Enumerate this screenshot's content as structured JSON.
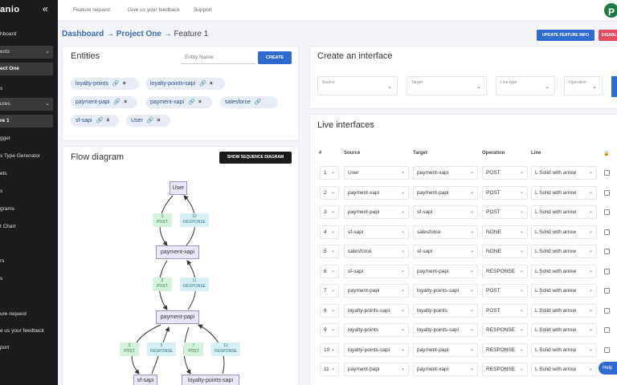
{
  "app": {
    "logo_text": "anio"
  },
  "sidebar": {
    "items": [
      {
        "label": "hboard"
      },
      {
        "label": "ects"
      },
      {
        "label": "ect One"
      },
      {
        "label": "s"
      },
      {
        "label": "ures"
      },
      {
        "label": "re 1"
      },
      {
        "label": "gger"
      },
      {
        "label": "s Type Generator"
      },
      {
        "label": "ets"
      },
      {
        "label": "s"
      },
      {
        "label": "grams"
      },
      {
        "label": "t Chart"
      },
      {
        "label": "rs"
      },
      {
        "label": "s"
      },
      {
        "label": "ure request"
      },
      {
        "label": "e us your feedback"
      },
      {
        "label": "port"
      }
    ]
  },
  "topbar": {
    "links": [
      "Feature request",
      "Give us your feedback",
      "Support"
    ],
    "avatar_letter": "P"
  },
  "breadcrumb": {
    "dashboard": "Dashboard",
    "sep": "→",
    "project": "Project One",
    "current": "Feature 1"
  },
  "actions": {
    "update_label": "UPDATE FEATURE INFO",
    "disable_label": "DISABLE"
  },
  "entities": {
    "title": "Entities",
    "input_placeholder": "Entity Name",
    "create_label": "CREATE",
    "chips": [
      "loyalty-points",
      "loyalty-points-sapi",
      "payment-papi",
      "payment-xapi",
      "salesforce",
      "sf-sapi",
      "User"
    ]
  },
  "flow": {
    "title": "Flow diagram",
    "seq_button": "SHOW SEQUENCE DIAGRAM",
    "nodes": [
      "User",
      "payment-xapi",
      "payment-papi",
      "sf-sapi",
      "loyalty-points-sapi"
    ],
    "labels": [
      {
        "n": "1",
        "op": "POST"
      },
      {
        "n": "12",
        "op": "RESPONSE"
      },
      {
        "n": "2",
        "op": "POST"
      },
      {
        "n": "11",
        "op": "RESPONSE"
      },
      {
        "n": "3",
        "op": "POST"
      },
      {
        "n": "6",
        "op": "RESPONSE"
      },
      {
        "n": "7",
        "op": "POST"
      },
      {
        "n": "10",
        "op": "RESPONSE"
      }
    ]
  },
  "create_interface": {
    "title": "Create an interface",
    "fields": [
      "Source",
      "Target",
      "Line type",
      "Operation"
    ]
  },
  "live": {
    "title": "Live interfaces",
    "columns": {
      "num": "#",
      "source": "Source",
      "target": "Target",
      "operation": "Operation",
      "line": "Line"
    },
    "rows": [
      {
        "n": "1",
        "source": "User",
        "target": "payment-xapi",
        "op": "POST",
        "line": "L Solid with arrow"
      },
      {
        "n": "2",
        "source": "payment-xapi",
        "target": "payment-papi",
        "op": "POST",
        "line": "L Solid with arrow"
      },
      {
        "n": "3",
        "source": "payment-papi",
        "target": "sf-sapi",
        "op": "POST",
        "line": "L Solid with arrow"
      },
      {
        "n": "4",
        "source": "sf-sapi",
        "target": "salesforce",
        "op": "NONE",
        "line": "L Solid with arrow"
      },
      {
        "n": "5",
        "source": "salesforce",
        "target": "sf-sapi",
        "op": "NONE",
        "line": "L Solid with arrow"
      },
      {
        "n": "6",
        "source": "sf-sapi",
        "target": "payment-papi",
        "op": "RESPONSE",
        "line": "L Solid with arrow"
      },
      {
        "n": "7",
        "source": "payment-papi",
        "target": "loyalty-points-sapi",
        "op": "POST",
        "line": "L Solid with arrow"
      },
      {
        "n": "8",
        "source": "loyalty-points-sapi",
        "target": "loyalty-points",
        "op": "POST",
        "line": "L Solid with arrow"
      },
      {
        "n": "9",
        "source": "loyalty-points",
        "target": "loyalty-points-sapi",
        "op": "RESPONSE",
        "line": "L Solid with arrow"
      },
      {
        "n": "10",
        "source": "loyalty-points-sapi",
        "target": "payment-papi",
        "op": "RESPONSE",
        "line": "L Solid with arrow"
      },
      {
        "n": "11",
        "source": "payment-papi",
        "target": "payment-xapi",
        "op": "RESPONSE",
        "line": "L Solid with arrow"
      }
    ]
  },
  "help_label": "Help"
}
